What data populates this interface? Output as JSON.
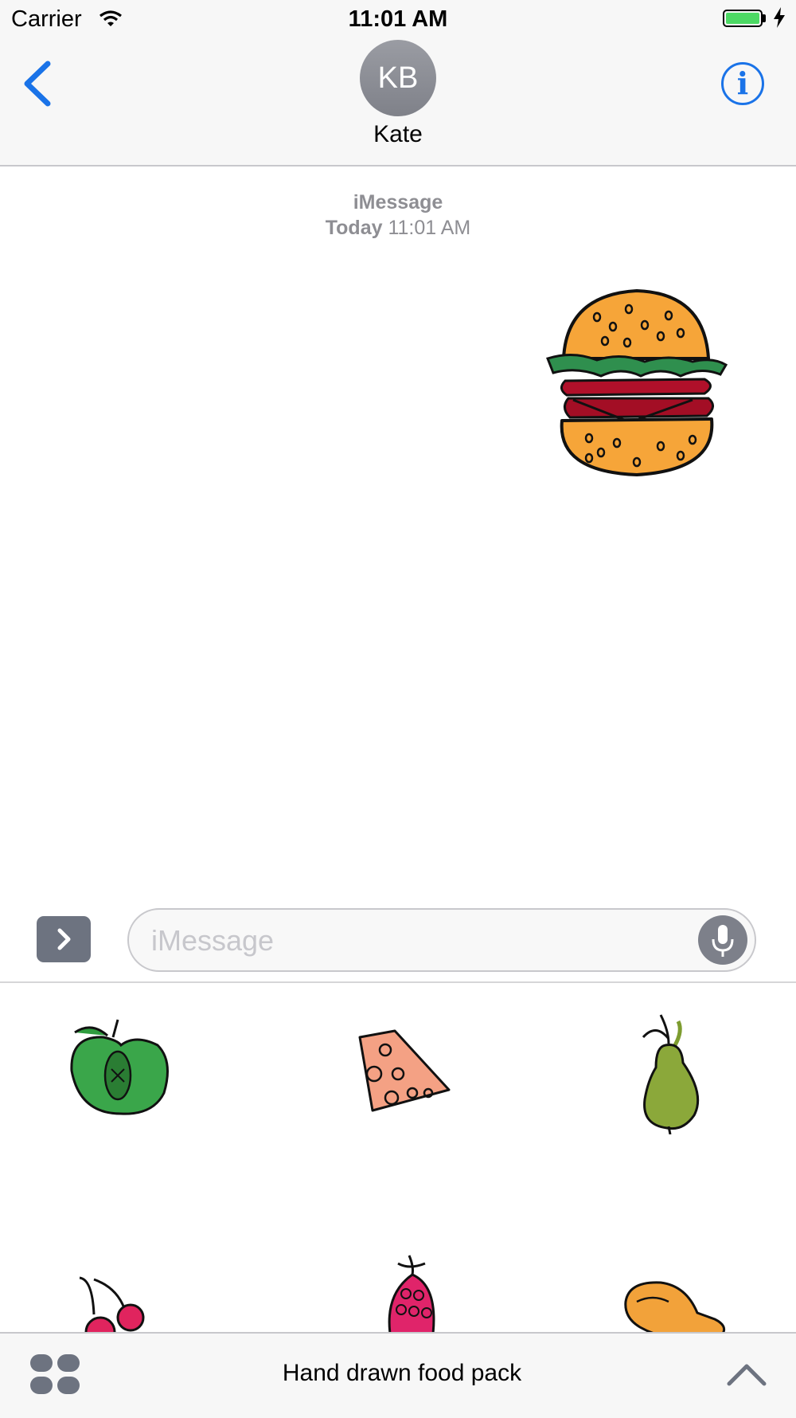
{
  "status_bar": {
    "carrier": "Carrier",
    "time": "11:01 AM",
    "battery_color": "#4cd964"
  },
  "header": {
    "avatar_initials": "KB",
    "contact_name": "Kate",
    "info_icon": "i",
    "back_icon": "chevron-left-icon",
    "accent_color": "#1a73e8"
  },
  "conversation": {
    "service": "iMessage",
    "timestamp_day": "Today",
    "timestamp_time": "11:01 AM",
    "sent_sticker": "hamburger-sticker"
  },
  "input": {
    "placeholder": "iMessage"
  },
  "drawer": {
    "stickers": [
      "apple",
      "cheese",
      "pear",
      "cherry",
      "raspberry",
      "chicken-leg"
    ]
  },
  "bottom_bar": {
    "pack_title": "Hand drawn food pack"
  }
}
